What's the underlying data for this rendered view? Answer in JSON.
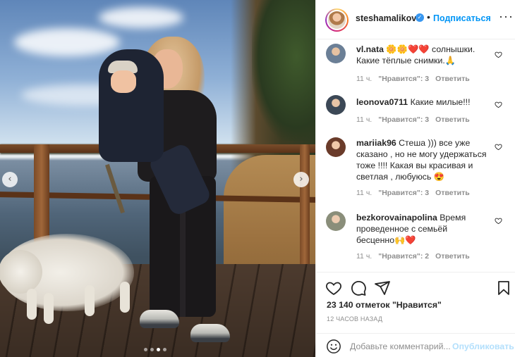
{
  "post": {
    "photo_alt_icons": {
      "prev": "chevron-left-icon",
      "next": "chevron-right-icon"
    },
    "carousel": {
      "count": 4,
      "active_index": 2
    }
  },
  "header": {
    "username": "steshamalikova",
    "verified_icon": "verified-badge-icon",
    "separator": "•",
    "follow_label": "Подписаться",
    "more_icon": "more-options-icon",
    "more_glyph": "···"
  },
  "comments": [
    {
      "user": "vl.nata",
      "text": "🌼🌼❤️❤️ солнышки. Какие тёплые снимки.🙏",
      "time": "11 ч.",
      "likes": "\"Нравится\": 3",
      "reply": "Ответить"
    },
    {
      "user": "leonova0711",
      "text": "Какие милые!!!",
      "time": "11 ч.",
      "likes": "\"Нравится\": 3",
      "reply": "Ответить"
    },
    {
      "user": "mariiak96",
      "text": "Стеша ))) все уже сказано , но не могу удержаться тоже !!!! Какая вы красивая и светлая , любуюсь 😍",
      "time": "11 ч.",
      "likes": "\"Нравится\": 3",
      "reply": "Ответить"
    },
    {
      "user": "bezkorovainapolina",
      "text": "Время проведенное с семьёй бесценно🙌❤️",
      "time": "11 ч.",
      "likes": "\"Нравится\": 2",
      "reply": "Ответить"
    }
  ],
  "actions": {
    "like_icon": "heart-icon",
    "comment_icon": "comment-icon",
    "share_icon": "share-icon",
    "save_icon": "bookmark-icon",
    "likes_total": "23 140 отметок \"Нравится\"",
    "time_ago": "12 ЧАСОВ НАЗАД"
  },
  "add_comment": {
    "emoji_icon": "emoji-icon",
    "placeholder": "Добавьте комментарий...",
    "publish_label": "Опубликовать"
  },
  "colors": {
    "accent": "#0095f6",
    "publish_disabled": "#b2dffc",
    "muted": "#8e8e8e",
    "text": "#262626",
    "verified": "#3897f0"
  }
}
